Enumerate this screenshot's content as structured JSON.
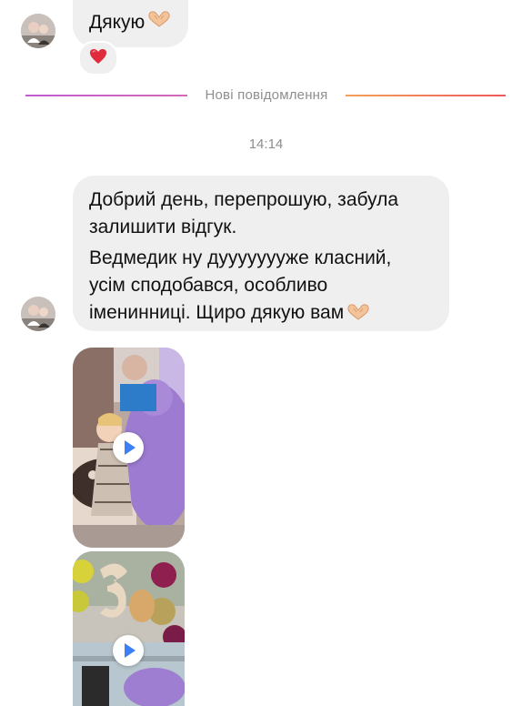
{
  "conversation": {
    "messages": [
      {
        "text": "Дякую",
        "emoji": "heart-hands-icon",
        "reaction": "red-heart-icon"
      }
    ],
    "new_messages_divider": "Нові повідомлення",
    "timestamp": "14:14",
    "message2": {
      "paragraph1": "Добрий день, перепрошую, забула залишити відгук.",
      "paragraph2": "Ведмедик ну дуууууууже класний, усім сподобався, особливо іменинниці. Щиро дякую вам",
      "emoji": "heart-hands-icon"
    },
    "attachments": [
      {
        "type": "video",
        "icon": "play-icon"
      },
      {
        "type": "video",
        "icon": "play-icon"
      }
    ]
  },
  "colors": {
    "bubble": "#efefef",
    "divider_left": "#c05bd2",
    "divider_right": "#ee5a5a",
    "meta_text": "#8e8e8e",
    "play_icon": "#3d7ff5",
    "heart": "#e02b3a"
  }
}
